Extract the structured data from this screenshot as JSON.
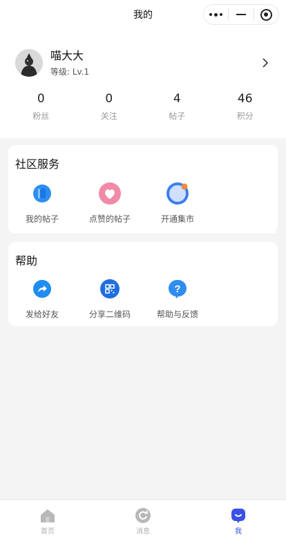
{
  "navbar": {
    "title": "我的",
    "more_icon": "more-dots-icon",
    "minimize_icon": "minimize-icon",
    "close_icon": "target-circle-icon"
  },
  "profile": {
    "username": "喵大大",
    "level_label": "等级:",
    "level_value": "Lv.1",
    "chevron_icon": "chevron-right-icon"
  },
  "stats": [
    {
      "value": "0",
      "label": "粉丝"
    },
    {
      "value": "0",
      "label": "关注"
    },
    {
      "value": "4",
      "label": "帖子"
    },
    {
      "value": "46",
      "label": "积分"
    }
  ],
  "community": {
    "title": "社区服务",
    "items": [
      {
        "label": "我的帖子",
        "icon": "my-posts-icon"
      },
      {
        "label": "点赞的帖子",
        "icon": "liked-posts-icon"
      },
      {
        "label": "开通集市",
        "icon": "open-market-icon"
      }
    ]
  },
  "help": {
    "title": "帮助",
    "items": [
      {
        "label": "发给好友",
        "icon": "share-arrow-icon"
      },
      {
        "label": "分享二维码",
        "icon": "qr-code-icon"
      },
      {
        "label": "帮助与反馈",
        "icon": "help-question-icon"
      }
    ]
  },
  "tabbar": {
    "tabs": [
      {
        "label": "首页",
        "icon": "home-icon"
      },
      {
        "label": "消息",
        "icon": "refresh-message-icon"
      },
      {
        "label": "我",
        "icon": "chat-bubble-icon"
      }
    ],
    "active_index": 2
  },
  "colors": {
    "accent": "#3a52e8",
    "blue_icon": "#2f8cf0",
    "pink_icon": "#f08aa6",
    "orange_dot": "#f08a3b"
  }
}
